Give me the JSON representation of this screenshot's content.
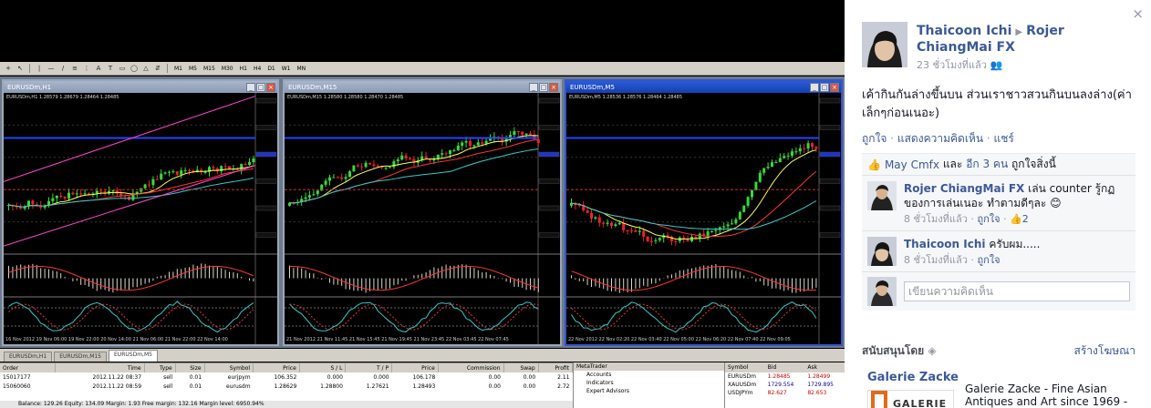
{
  "terminal": {
    "timeframes": [
      "M1",
      "M5",
      "M15",
      "M30",
      "H1",
      "H4",
      "D1",
      "W1",
      "MN"
    ],
    "charts": [
      {
        "title": "EURUSDm,H1",
        "quote": "EURUSDm,H1  1.28579 1.28679 1.28464 1.28485",
        "footer": "16 Nov 2012   19 Nov 06:00   19 Nov 22:00   20 Nov 14:00   21 Nov 06:00   21 Nov 22:00   22 Nov 14:00",
        "macd_label": "MACD(12,26,9) 0.00138 0.00621 0.001637",
        "stoch_label": "Stoch(5,3,3) 63.6438 65.8586"
      },
      {
        "title": "EURUSDm,M15",
        "quote": "EURUSDm,M15  1.28580 1.28580 1.28470 1.28485",
        "footer": "21 Nov 2012   21 Nov 11:45   21 Nov 15:45   21 Nov 19:45   21 Nov 23:45   22 Nov 03:45   22 Nov 07:45",
        "macd_label": "MACD(12,26,9) 0.00026 0.00196",
        "stoch_label": "Stoch(5,3,3) 48.4211 53.9286"
      },
      {
        "title": "EURUSDm,M5",
        "quote": "EURUSDm,M5  1.28536 1.28576 1.28464 1.28485",
        "footer": "22 Nov 2012   22 Nov 02:20   22 Nov 03:40   22 Nov 05:00   22 Nov 06:20   22 Nov 07:40   22 Nov 09:05",
        "macd_label": "MACD(12,26,9) 0.00072 0.00094 MA(3) 0.00210",
        "stoch_label": "Stoch(5,3,3) 34.6656 65.7260"
      }
    ],
    "tabs": [
      "EURUSDm,H1",
      "EURUSDm,M15",
      "EURUSDm,M5"
    ],
    "orders": {
      "headers": [
        "Order",
        "Time",
        "Type",
        "Size",
        "Symbol",
        "Price",
        "S / L",
        "T / P",
        "Price",
        "Commission",
        "Swap",
        "Profit"
      ],
      "rows": [
        [
          "15017177",
          "2012.11.22 08:37",
          "sell",
          "0.01",
          "eurjpym",
          "106.352",
          "0.000",
          "0.000",
          "106.178",
          "0.00",
          "0.00",
          "2.11"
        ],
        [
          "15060060",
          "2012.11.22 08:59",
          "sell",
          "0.01",
          "eurusdm",
          "1.28629",
          "1.28800",
          "1.27621",
          "1.28493",
          "0.00",
          "0.00",
          "2.72"
        ]
      ],
      "balance": "Balance: 129.26  Equity: 134.09  Margin: 1.93  Free margin: 132.16  Margin level: 6950.94%"
    },
    "navigator": {
      "head": "MetaTrader",
      "items": [
        "Accounts",
        "Indicators",
        "Expert Advisors"
      ]
    },
    "marketwatch": {
      "headers": [
        "Symbol",
        "Bid",
        "Ask"
      ],
      "rows": [
        [
          "EURUSDm",
          "1.28485",
          "1.28499"
        ],
        [
          "XAUUSDm",
          "1729.554",
          "1729.895"
        ],
        [
          "USDJPYm",
          "82.627",
          "82.653"
        ]
      ]
    }
  },
  "sidebar": {
    "close": "×",
    "author_name": "Thaicoon Ichi",
    "target_name": "Rojer ChiangMai FX",
    "time": "23 ชั่วโมงที่แล้ว",
    "caption": "เค้ากินกันล่างขึ้นบน ส่วนเราชาวสวนกินบนลงล่าง(ค่าเล็กๆก่อนเนอะ)",
    "actions": {
      "like": "ถูกใจ",
      "comment": "แสดงความคิดเห็น",
      "share": "แชร์",
      "sep": " · "
    },
    "likes": {
      "name": "May Cmfx",
      "connector": "และ",
      "others": "อีก 3 คน",
      "suffix": "ถูกใจสิ่งนี้"
    },
    "comments": [
      {
        "author": "Rojer ChiangMai FX",
        "text": "เล่น counter รู้กฏของการเล่นเนอะ ทำตามดีๆละ 😊",
        "time": "8 ชั่วโมงที่แล้ว",
        "like": "ถูกใจ",
        "like_count": "2"
      },
      {
        "author": "Thaicoon Ichi",
        "text": "ครับผม.....",
        "time": "8 ชั่วโมงที่แล้ว",
        "like": "ถูกใจ"
      }
    ],
    "composer_placeholder": "เขียนความคิดเห็น",
    "sponsored": {
      "title": "สนับสนุนโดย",
      "create_ad": "สร้างโฆษณา"
    },
    "ad": {
      "title": "Galerie Zacke",
      "logo_text": "GALERIE",
      "description": "Galerie Zacke - Fine Asian Antiques and Art since 1969 -"
    }
  }
}
